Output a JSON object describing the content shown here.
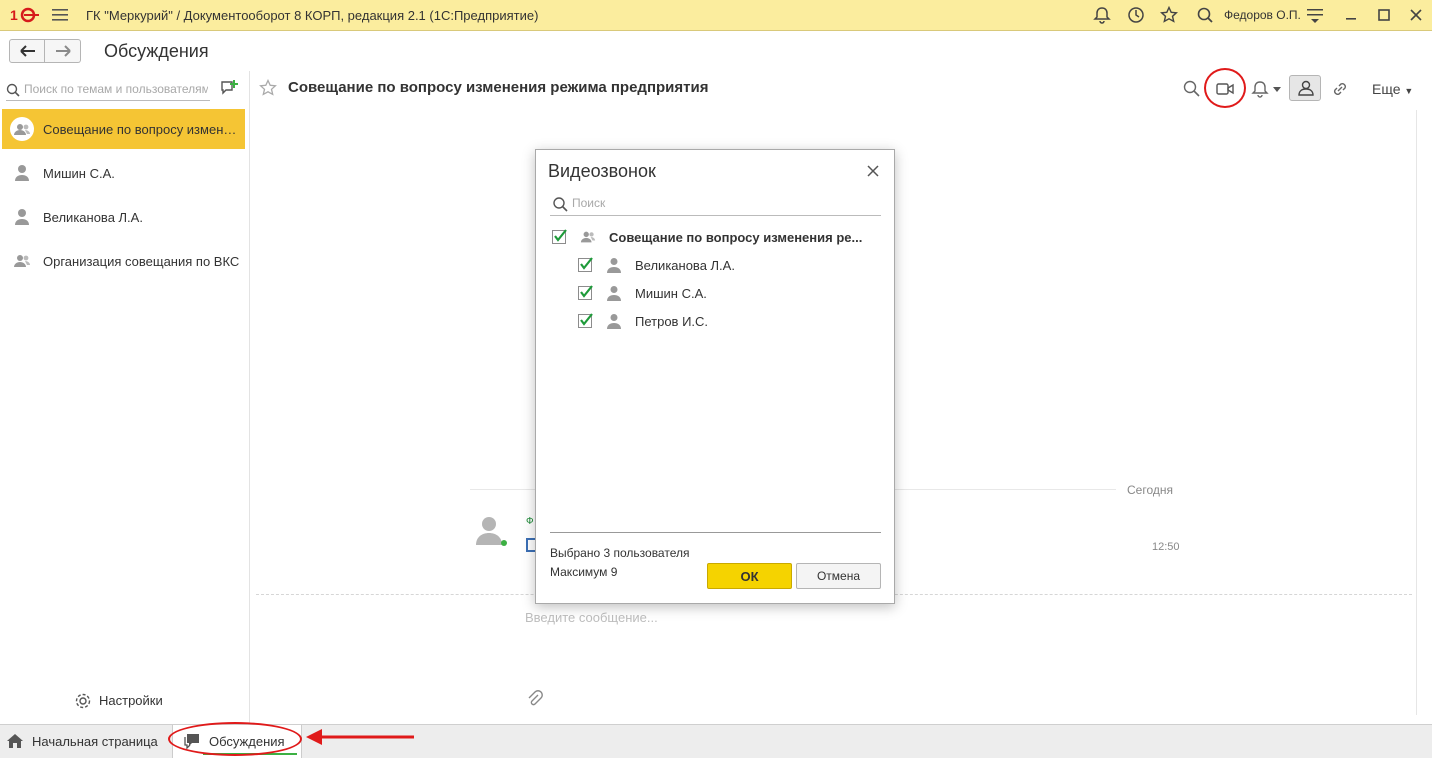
{
  "titlebar": {
    "title": "ГК \"Меркурий\" / Документооборот 8 КОРП, редакция 2.1  (1С:Предприятие)",
    "user": "Федоров О.П.",
    "icons": [
      "logo-1c",
      "hamburger-icon",
      "bell-icon",
      "history-icon",
      "star-icon",
      "search-icon",
      "settings-lines-icon",
      "minimize-icon",
      "maximize-icon",
      "close-icon"
    ]
  },
  "nav": {
    "page_title": "Обсуждения"
  },
  "sidebar": {
    "search_placeholder": "Поиск по темам и пользователям",
    "conversations": [
      {
        "label": "Совещание по вопросу изменения режима предприятия",
        "type": "group",
        "selected": true
      },
      {
        "label": "Мишин С.А.",
        "type": "user",
        "selected": false
      },
      {
        "label": "Великанова Л.А.",
        "type": "user",
        "selected": false
      },
      {
        "label": "Организация совещания по ВКС",
        "type": "group",
        "selected": false
      }
    ],
    "settings_label": "Настройки"
  },
  "chat": {
    "title": "Совещание по вопросу изменения режима предприятия",
    "more_label": "Еще",
    "date_separator": "Сегодня",
    "message": {
      "author_initial": "Ф",
      "time": "12:50"
    },
    "input_placeholder": "Введите сообщение..."
  },
  "dialog": {
    "title": "Видеозвонок",
    "search_placeholder": "Поиск",
    "group": {
      "label": "Совещание по вопросу изменения ре...",
      "checked": true
    },
    "participants": [
      {
        "label": "Великанова Л.А.",
        "checked": true
      },
      {
        "label": "Мишин С.А.",
        "checked": true
      },
      {
        "label": "Петров И.С.",
        "checked": true
      }
    ],
    "selected_text": "Выбрано 3 пользователя",
    "max_text": "Максимум 9",
    "ok_label": "ОК",
    "cancel_label": "Отмена"
  },
  "bottombar": {
    "home_label": "Начальная страница",
    "discussions_label": "Обсуждения"
  },
  "colors": {
    "titlebar_bg": "#fbed9e",
    "selected_bg": "#f5c534",
    "ok_button": "#f5d300",
    "annotation_red": "#e01a1a",
    "online_green": "#3cb043"
  }
}
